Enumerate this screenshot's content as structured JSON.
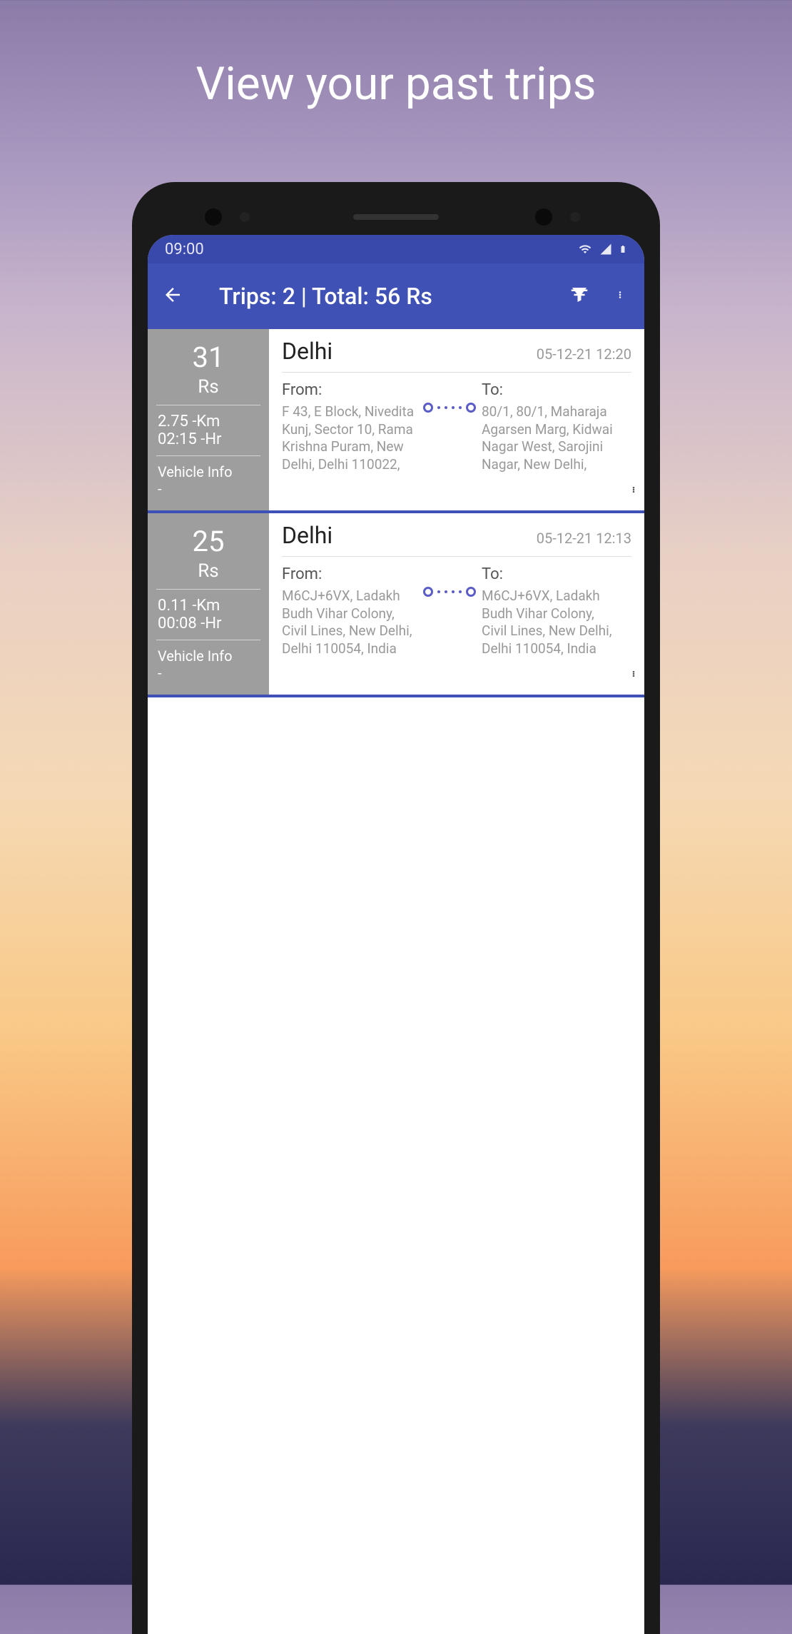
{
  "promo_title": "View your past trips",
  "status_bar": {
    "time": "09:00"
  },
  "app_bar": {
    "title": "Trips: 2 | Total: 56 Rs"
  },
  "trips": [
    {
      "fare_amount": "31",
      "fare_currency": "Rs",
      "distance": "2.75 -Km",
      "duration": "02:15 -Hr",
      "vehicle_label": "Vehicle Info",
      "vehicle_value": "-",
      "city": "Delhi",
      "timestamp": "05-12-21 12:20",
      "from_label": "From:",
      "from_address": "F 43, E Block, Nivedita Kunj, Sector 10, Rama Krishna Puram, New Delhi, Delhi 110022,",
      "to_label": "To:",
      "to_address": "80/1, 80/1, Maharaja Agarsen Marg, Kidwai Nagar West, Sarojini Nagar, New Delhi,"
    },
    {
      "fare_amount": "25",
      "fare_currency": "Rs",
      "distance": "0.11 -Km",
      "duration": "00:08 -Hr",
      "vehicle_label": "Vehicle Info",
      "vehicle_value": "-",
      "city": "Delhi",
      "timestamp": "05-12-21 12:13",
      "from_label": "From:",
      "from_address": "M6CJ+6VX, Ladakh Budh Vihar Colony, Civil Lines, New Delhi, Delhi 110054, India",
      "to_label": "To:",
      "to_address": "M6CJ+6VX, Ladakh Budh Vihar Colony, Civil Lines, New Delhi, Delhi 110054, India"
    }
  ]
}
